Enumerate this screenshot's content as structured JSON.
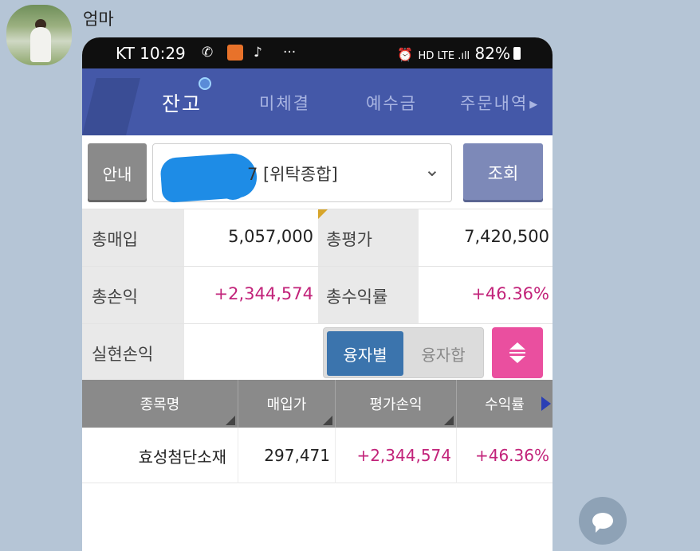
{
  "chat": {
    "sender_name": "엄마"
  },
  "status_bar": {
    "carrier_time": "KT 10:29",
    "right_text": "82%",
    "icons": [
      "hd-icon",
      "lte-icon",
      "signal-icon",
      "alarm-icon",
      "battery-icon"
    ]
  },
  "tabs": [
    {
      "label": "잔고",
      "active": true
    },
    {
      "label": "미체결",
      "active": false
    },
    {
      "label": "예수금",
      "active": false
    },
    {
      "label": "주문내역",
      "active": false
    }
  ],
  "account": {
    "guide_label": "안내",
    "number_suffix": "7 [위탁종합]",
    "query_label": "조회"
  },
  "summary": {
    "total_purchase_label": "총매입",
    "total_purchase": "5,057,000",
    "total_eval_label": "총평가",
    "total_eval": "7,420,500",
    "total_pl_label": "총손익",
    "total_pl": "+2,344,574",
    "total_return_label": "총수익률",
    "total_return": "+46.36%",
    "realized_pl_label": "실현손익",
    "realized_pl": ""
  },
  "segment": {
    "option1": "융자별",
    "option2": "융자합"
  },
  "table": {
    "headers": [
      "종목명",
      "매입가",
      "평가손익",
      "수익률"
    ],
    "rows": [
      {
        "name": "효성첨단소재",
        "price": "297,471",
        "pl": "+2,344,574",
        "ret": "+46.36%"
      }
    ]
  },
  "colors": {
    "header_blue": "#4458a8",
    "gain_pink": "#c2237a",
    "seg_active": "#3b74ad"
  }
}
